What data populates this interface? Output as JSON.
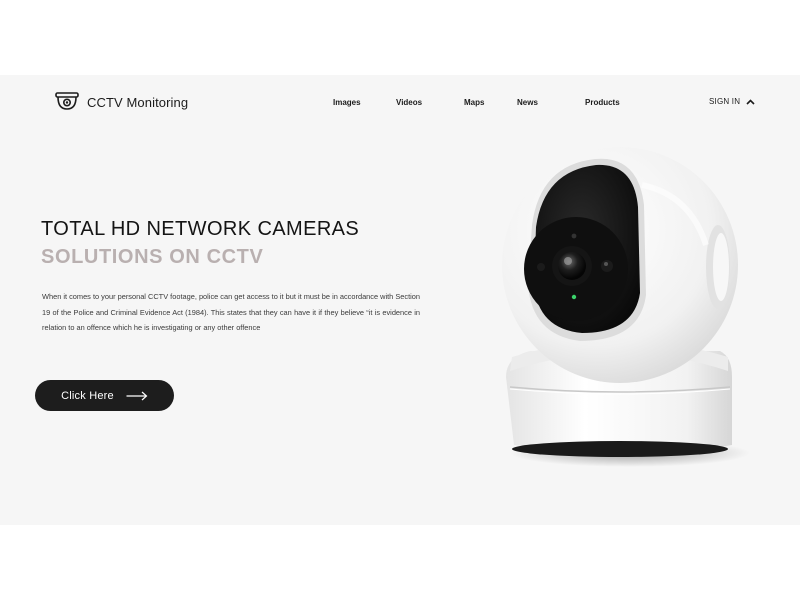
{
  "header": {
    "brand": "CCTV Monitoring",
    "logo_icon": "security-camera-icon",
    "nav": [
      "Images",
      "Videos",
      "Maps",
      "News",
      "Products"
    ],
    "signin_label": "SIGN IN",
    "signin_icon": "chevron-up-icon"
  },
  "hero": {
    "title_line1": "TOTAL HD NETWORK CAMERAS",
    "title_line2": "SOLUTIONS ON CCTV",
    "description": "When it comes to your personal CCTV footage, police can get access to it but it must be in accordance with Section 19 of the Police and Criminal Evidence Act (1984). This states that they can have it if they believe “it is evidence in relation to an offence which he is investigating or any other offence",
    "cta_label": "Click Here",
    "cta_icon": "arrow-right-icon",
    "image": "white-dome-security-camera"
  },
  "colors": {
    "hero_background": "#f6f6f6",
    "title_primary": "#141414",
    "title_accent": "#b9b0b0",
    "button_background": "#1d1d1d",
    "button_text": "#ffffff"
  }
}
